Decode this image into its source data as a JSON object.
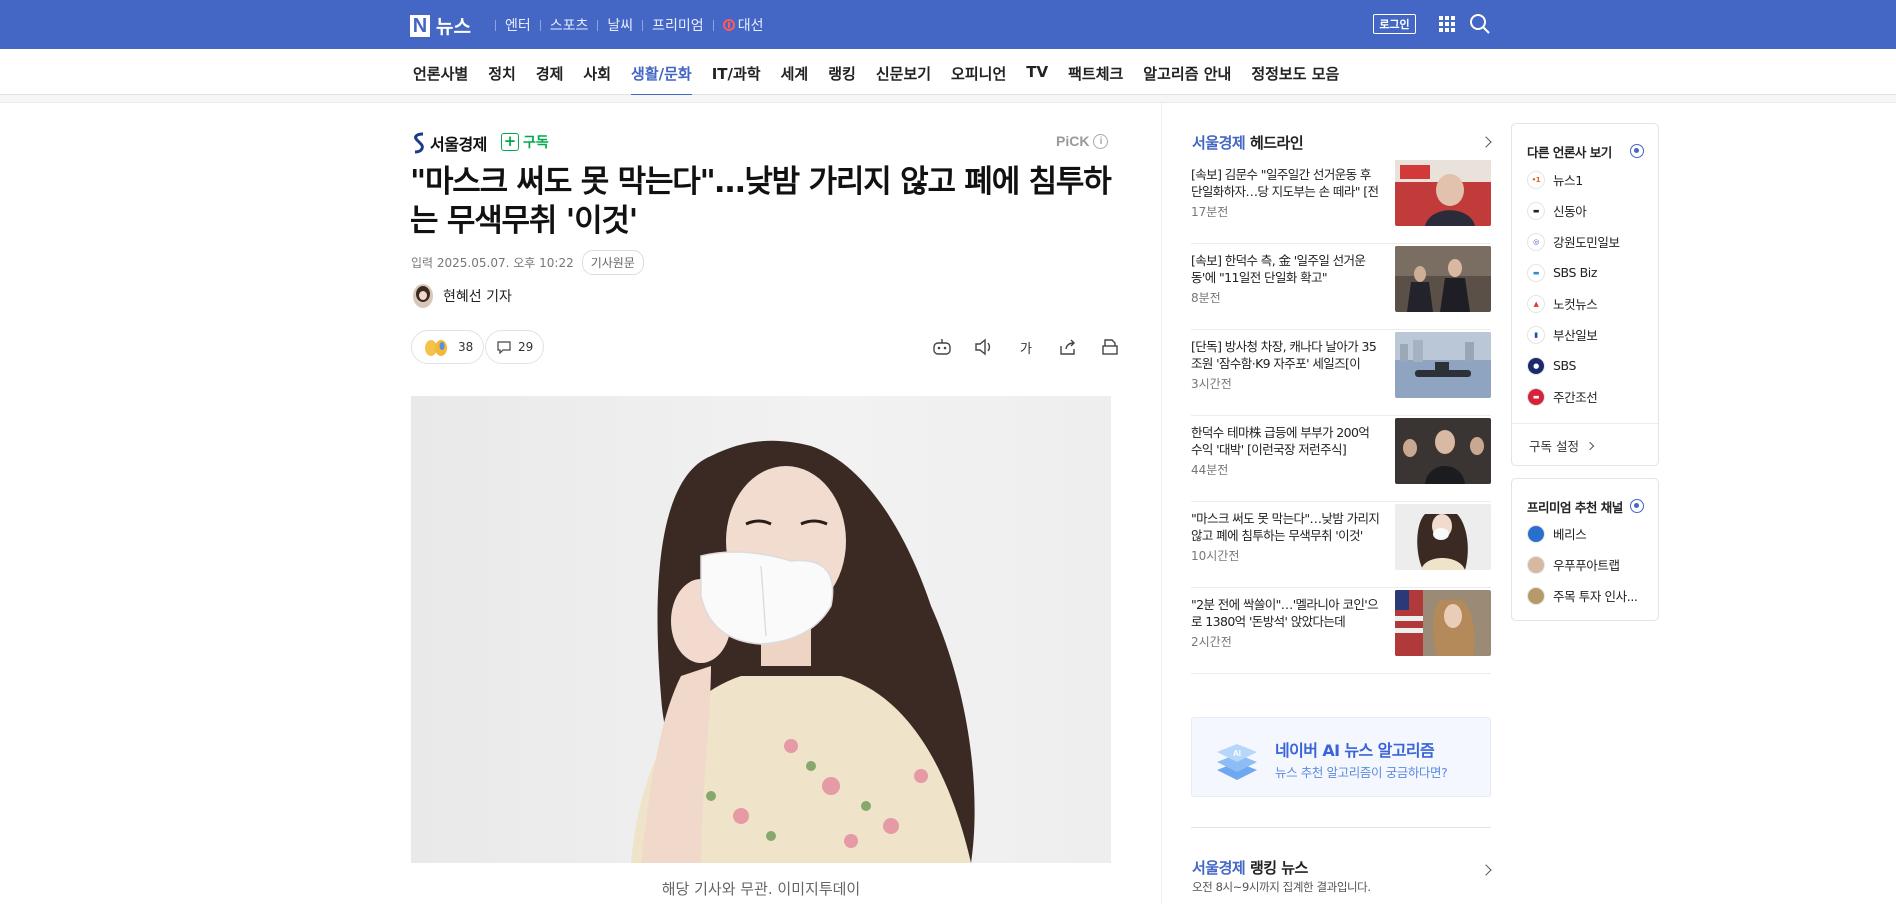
{
  "topbar": {
    "logo_letter": "N",
    "logo_text": "뉴스",
    "links": [
      "엔터",
      "스포츠",
      "날씨",
      "프리미엄"
    ],
    "election": "대선",
    "login": "로그인",
    "bg_color": "#4466c4"
  },
  "categories": [
    "언론사별",
    "정치",
    "경제",
    "사회",
    "생활/문화",
    "IT/과학",
    "세계",
    "랭킹",
    "신문보기",
    "오피니언",
    "TV",
    "팩트체크",
    "알고리즘 안내",
    "정정보도 모음"
  ],
  "active_category": "생활/문화",
  "article": {
    "press_name": "서울경제",
    "subscribe": "구독",
    "pick": "PiCK",
    "pick_info": "i",
    "headline": "\"마스크 써도 못 막는다\"…낮밤 가리지 않고 폐에 침투하는 무색무취 '이것'",
    "date_label": "입력 2025.05.07. 오후 10:22",
    "original_button": "기사원문",
    "reporter": "현혜선 기자",
    "reaction_count": "38",
    "comment_count": "29",
    "font_size_label": "가",
    "photo_caption": "해당 기사와 무관. 이미지투데이"
  },
  "headlines_panel": {
    "press": "서울경제",
    "title_suffix": "헤드라인",
    "items": [
      {
        "text": "[속보] 김문수 \"일주일간 선거운동 후 단일화하자…당 지도부는 손 떼라\" [전문]",
        "time": "17분전"
      },
      {
        "text": "[속보] 한덕수 측, 金 '일주일 선거운동'에 \"11일전 단일화 확고\"",
        "time": "8분전"
      },
      {
        "text": "[단독] 방사청 차장, 캐나다 날아가 35조원 '잠수함·K9 자주포' 세일즈[이슈…",
        "time": "3시간전"
      },
      {
        "text": "한덕수 테마株 급등에 부부가 200억 수익 '대박' [이런국장 저런주식]",
        "time": "44분전"
      },
      {
        "text": "\"마스크 써도 못 막는다\"…낮밤 가리지 않고 폐에 침투하는 무색무취 '이것'",
        "time": "10시간전"
      },
      {
        "text": "\"2분 전에 싹쓸이\"…'멜라니아 코인'으로 1380억 '돈방석' 앉았다는데",
        "time": "2시간전"
      }
    ]
  },
  "ai_box": {
    "title": "네이버 AI 뉴스 알고리즘",
    "subtitle": "뉴스 추천 알고리즘이 궁금하다면?",
    "icon_text": "AI"
  },
  "ranking": {
    "press": "서울경제",
    "title_suffix": "랭킹 뉴스",
    "subtitle": "오전 8시~9시까지 집계한 결과입니다."
  },
  "other_press": {
    "title": "다른 언론사 보기",
    "items": [
      "뉴스1",
      "신동아",
      "강원도민일보",
      "SBS Biz",
      "노컷뉴스",
      "부산일보",
      "SBS",
      "주간조선"
    ],
    "footer": "구독 설정"
  },
  "premium": {
    "title": "프리미엄 추천 채널",
    "items": [
      "베리스",
      "우푸푸아트랩",
      "주목 투자 인사..."
    ]
  },
  "colors": {
    "accent": "#4466c4",
    "subscribe_green": "#03a94d"
  }
}
